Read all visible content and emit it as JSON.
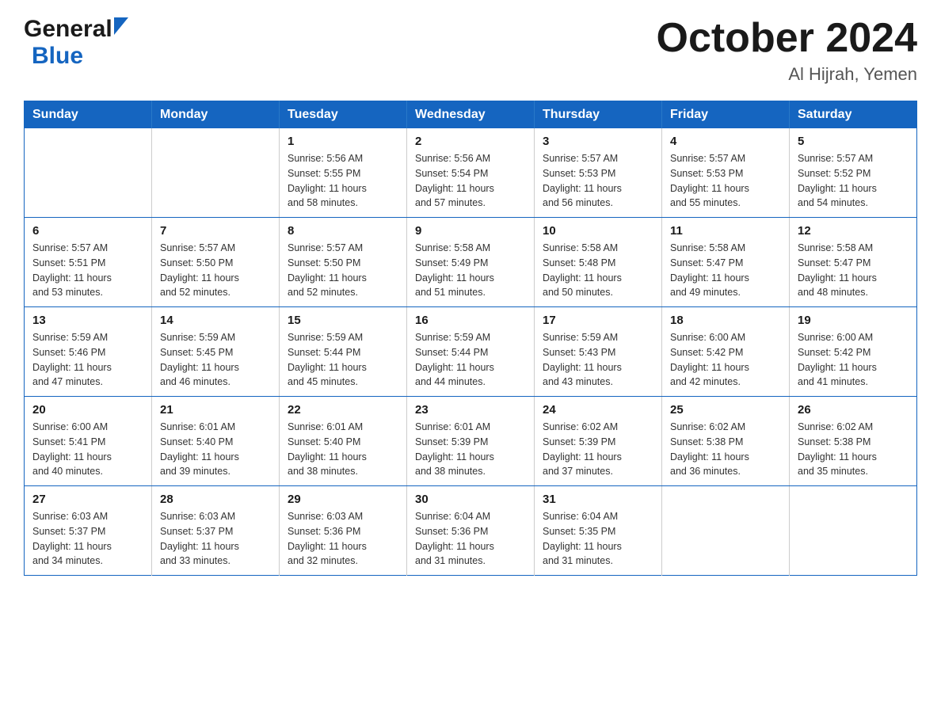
{
  "logo": {
    "general": "General",
    "blue": "Blue"
  },
  "title": "October 2024",
  "location": "Al Hijrah, Yemen",
  "headers": [
    "Sunday",
    "Monday",
    "Tuesday",
    "Wednesday",
    "Thursday",
    "Friday",
    "Saturday"
  ],
  "weeks": [
    [
      {
        "day": "",
        "info": ""
      },
      {
        "day": "",
        "info": ""
      },
      {
        "day": "1",
        "info": "Sunrise: 5:56 AM\nSunset: 5:55 PM\nDaylight: 11 hours\nand 58 minutes."
      },
      {
        "day": "2",
        "info": "Sunrise: 5:56 AM\nSunset: 5:54 PM\nDaylight: 11 hours\nand 57 minutes."
      },
      {
        "day": "3",
        "info": "Sunrise: 5:57 AM\nSunset: 5:53 PM\nDaylight: 11 hours\nand 56 minutes."
      },
      {
        "day": "4",
        "info": "Sunrise: 5:57 AM\nSunset: 5:53 PM\nDaylight: 11 hours\nand 55 minutes."
      },
      {
        "day": "5",
        "info": "Sunrise: 5:57 AM\nSunset: 5:52 PM\nDaylight: 11 hours\nand 54 minutes."
      }
    ],
    [
      {
        "day": "6",
        "info": "Sunrise: 5:57 AM\nSunset: 5:51 PM\nDaylight: 11 hours\nand 53 minutes."
      },
      {
        "day": "7",
        "info": "Sunrise: 5:57 AM\nSunset: 5:50 PM\nDaylight: 11 hours\nand 52 minutes."
      },
      {
        "day": "8",
        "info": "Sunrise: 5:57 AM\nSunset: 5:50 PM\nDaylight: 11 hours\nand 52 minutes."
      },
      {
        "day": "9",
        "info": "Sunrise: 5:58 AM\nSunset: 5:49 PM\nDaylight: 11 hours\nand 51 minutes."
      },
      {
        "day": "10",
        "info": "Sunrise: 5:58 AM\nSunset: 5:48 PM\nDaylight: 11 hours\nand 50 minutes."
      },
      {
        "day": "11",
        "info": "Sunrise: 5:58 AM\nSunset: 5:47 PM\nDaylight: 11 hours\nand 49 minutes."
      },
      {
        "day": "12",
        "info": "Sunrise: 5:58 AM\nSunset: 5:47 PM\nDaylight: 11 hours\nand 48 minutes."
      }
    ],
    [
      {
        "day": "13",
        "info": "Sunrise: 5:59 AM\nSunset: 5:46 PM\nDaylight: 11 hours\nand 47 minutes."
      },
      {
        "day": "14",
        "info": "Sunrise: 5:59 AM\nSunset: 5:45 PM\nDaylight: 11 hours\nand 46 minutes."
      },
      {
        "day": "15",
        "info": "Sunrise: 5:59 AM\nSunset: 5:44 PM\nDaylight: 11 hours\nand 45 minutes."
      },
      {
        "day": "16",
        "info": "Sunrise: 5:59 AM\nSunset: 5:44 PM\nDaylight: 11 hours\nand 44 minutes."
      },
      {
        "day": "17",
        "info": "Sunrise: 5:59 AM\nSunset: 5:43 PM\nDaylight: 11 hours\nand 43 minutes."
      },
      {
        "day": "18",
        "info": "Sunrise: 6:00 AM\nSunset: 5:42 PM\nDaylight: 11 hours\nand 42 minutes."
      },
      {
        "day": "19",
        "info": "Sunrise: 6:00 AM\nSunset: 5:42 PM\nDaylight: 11 hours\nand 41 minutes."
      }
    ],
    [
      {
        "day": "20",
        "info": "Sunrise: 6:00 AM\nSunset: 5:41 PM\nDaylight: 11 hours\nand 40 minutes."
      },
      {
        "day": "21",
        "info": "Sunrise: 6:01 AM\nSunset: 5:40 PM\nDaylight: 11 hours\nand 39 minutes."
      },
      {
        "day": "22",
        "info": "Sunrise: 6:01 AM\nSunset: 5:40 PM\nDaylight: 11 hours\nand 38 minutes."
      },
      {
        "day": "23",
        "info": "Sunrise: 6:01 AM\nSunset: 5:39 PM\nDaylight: 11 hours\nand 38 minutes."
      },
      {
        "day": "24",
        "info": "Sunrise: 6:02 AM\nSunset: 5:39 PM\nDaylight: 11 hours\nand 37 minutes."
      },
      {
        "day": "25",
        "info": "Sunrise: 6:02 AM\nSunset: 5:38 PM\nDaylight: 11 hours\nand 36 minutes."
      },
      {
        "day": "26",
        "info": "Sunrise: 6:02 AM\nSunset: 5:38 PM\nDaylight: 11 hours\nand 35 minutes."
      }
    ],
    [
      {
        "day": "27",
        "info": "Sunrise: 6:03 AM\nSunset: 5:37 PM\nDaylight: 11 hours\nand 34 minutes."
      },
      {
        "day": "28",
        "info": "Sunrise: 6:03 AM\nSunset: 5:37 PM\nDaylight: 11 hours\nand 33 minutes."
      },
      {
        "day": "29",
        "info": "Sunrise: 6:03 AM\nSunset: 5:36 PM\nDaylight: 11 hours\nand 32 minutes."
      },
      {
        "day": "30",
        "info": "Sunrise: 6:04 AM\nSunset: 5:36 PM\nDaylight: 11 hours\nand 31 minutes."
      },
      {
        "day": "31",
        "info": "Sunrise: 6:04 AM\nSunset: 5:35 PM\nDaylight: 11 hours\nand 31 minutes."
      },
      {
        "day": "",
        "info": ""
      },
      {
        "day": "",
        "info": ""
      }
    ]
  ]
}
